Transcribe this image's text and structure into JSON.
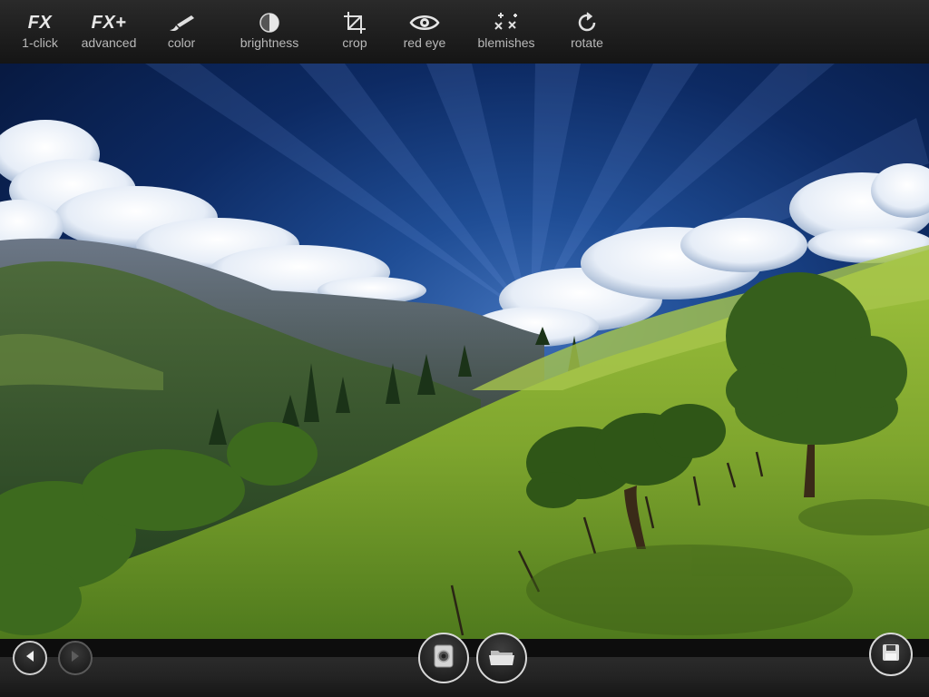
{
  "toolbar": {
    "tools": [
      {
        "label": "1-click",
        "icon": "fx-icon",
        "text": "FX"
      },
      {
        "label": "advanced",
        "icon": "fx-plus-icon",
        "text": "FX+"
      },
      {
        "label": "color",
        "icon": "paintbrush-icon"
      },
      {
        "label": "brightness",
        "icon": "half-circle-icon"
      },
      {
        "label": "crop",
        "icon": "crop-icon"
      },
      {
        "label": "red eye",
        "icon": "eye-icon"
      },
      {
        "label": "blemishes",
        "icon": "sparkle-x-icon"
      },
      {
        "label": "rotate",
        "icon": "rotate-icon"
      }
    ]
  },
  "photo": {
    "subject": "landscape-photo"
  },
  "bottom": {
    "prev_icon": "arrow-left-icon",
    "next_icon": "arrow-right-icon",
    "camera_icon": "camera-icon",
    "album_icon": "folder-icon",
    "save_icon": "save-icon"
  },
  "colors": {
    "toolbar": "#1d1d1d",
    "label": "#b9b9b9",
    "sky": "#0d2a63",
    "grass": "#7fa62e"
  }
}
